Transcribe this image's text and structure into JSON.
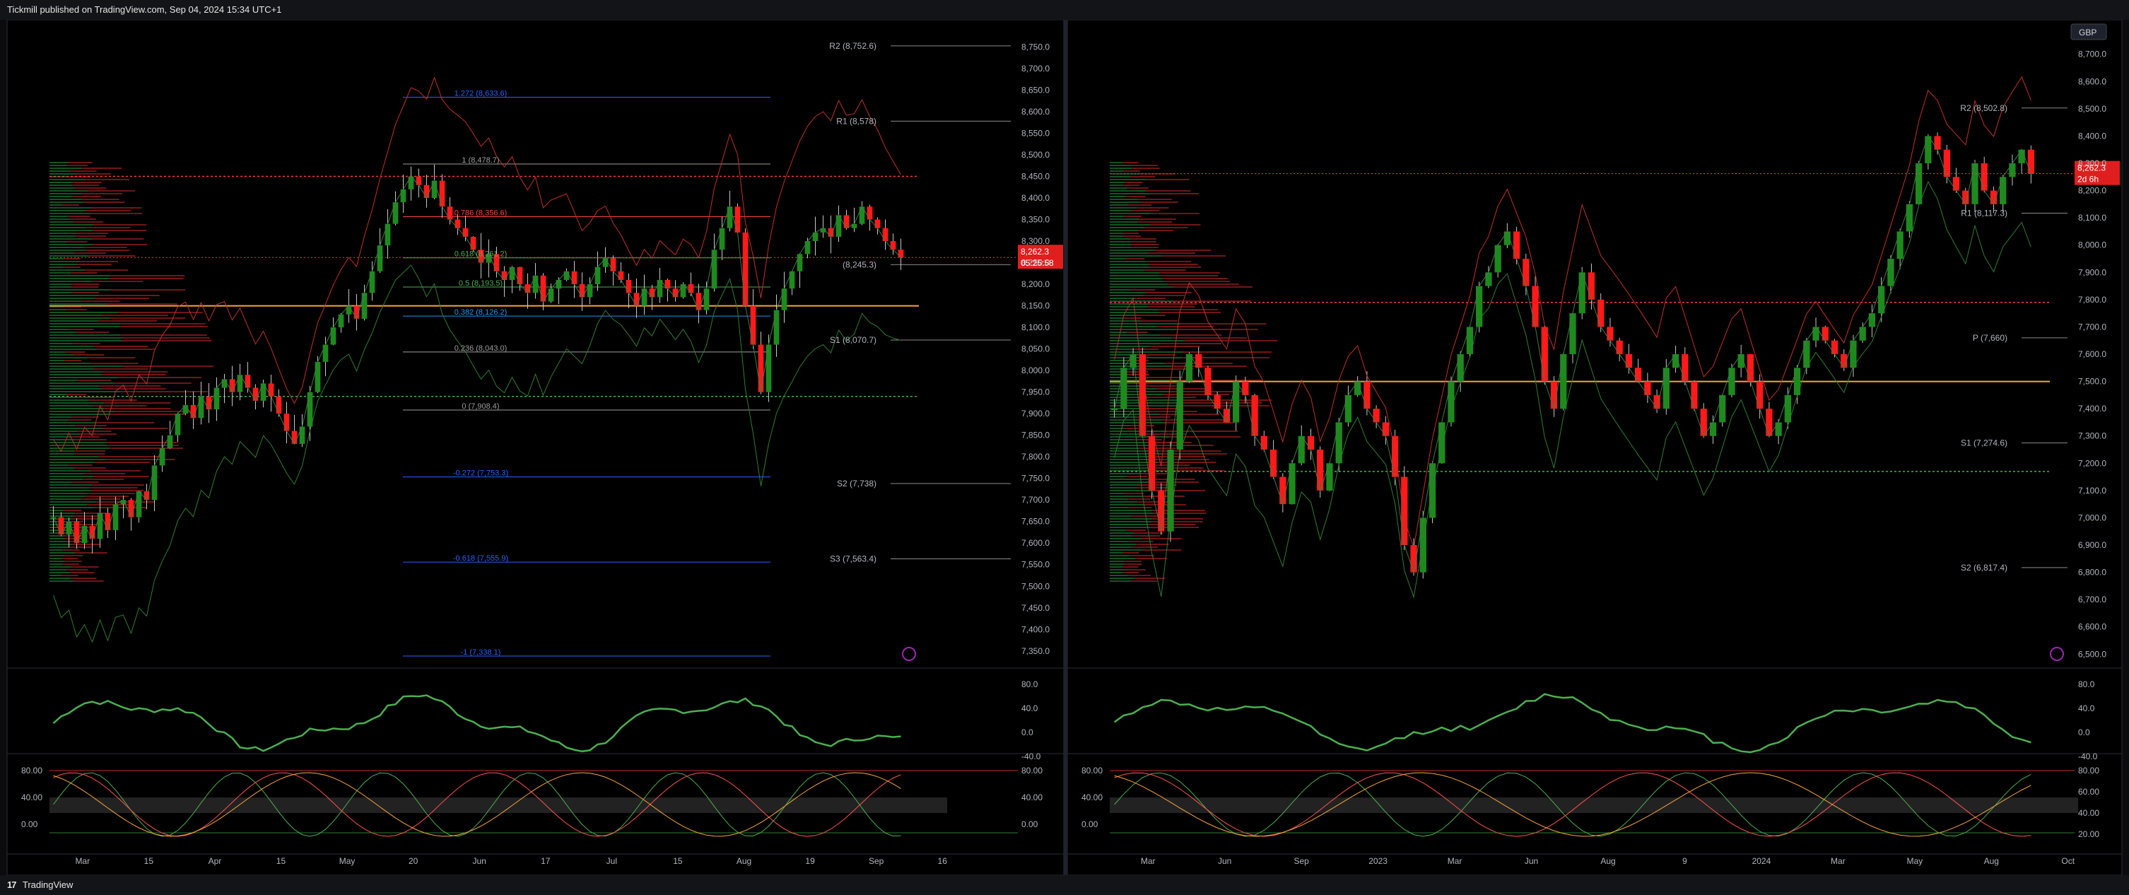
{
  "header": {
    "publish_text": "Tickmill published on TradingView.com, Sep 04, 2024 15:34 UTC+1"
  },
  "footer": {
    "brand": "TradingView",
    "logo_glyph": "17"
  },
  "colors": {
    "bg": "#000000",
    "panel_border": "#2a2e39",
    "up": "#1e8a1e",
    "down": "#ff1a1a",
    "grid_text": "#b2b5be",
    "orange": "#f7a53a",
    "blue_fib": "#2962ff",
    "bb": "#c0302a",
    "bb_green": "#2e7d32"
  },
  "chart_data": [
    {
      "type": "candlestick",
      "panel": "left",
      "timeframe_labels": [
        "Mar",
        "15",
        "Apr",
        "15",
        "May",
        "20",
        "Jun",
        "17",
        "Jul",
        "15",
        "Aug",
        "19",
        "Sep",
        "16"
      ],
      "ylim": [
        7330,
        8790
      ],
      "y_ticks": [
        "8,750.0",
        "8,700.0",
        "8,650.0",
        "8,600.0",
        "8,550.0",
        "8,500.0",
        "8,450.0",
        "8,400.0",
        "8,350.0",
        "8,300.0",
        "8,250.0",
        "8,200.0",
        "8,150.0",
        "8,100.0",
        "8,050.0",
        "8,000.0",
        "7,950.0",
        "7,900.0",
        "7,850.0",
        "7,800.0",
        "7,750.0",
        "7,700.0",
        "7,650.0",
        "7,600.0",
        "7,550.0",
        "7,500.0",
        "7,450.0",
        "7,400.0",
        "7,350.0"
      ],
      "last_price": "8,262.3",
      "countdown": "05:25:58",
      "pivot_levels": [
        {
          "label": "R2 (8,752.6)",
          "value": 8752.6
        },
        {
          "label": "R1 (8,578)",
          "value": 8578
        },
        {
          "label": "(8,245.3)",
          "value": 8245.3
        },
        {
          "label": "S1 (8,070.7)",
          "value": 8070.7
        },
        {
          "label": "S2 (7,738)",
          "value": 7738
        },
        {
          "label": "S3 (7,563.4)",
          "value": 7563.4
        }
      ],
      "fib_levels": [
        {
          "label": "1.272 (8,633.6)",
          "value": 8633.6,
          "color": "#2962ff"
        },
        {
          "label": "1 (8,478.7)",
          "value": 8478.7,
          "color": "#9e9e9e"
        },
        {
          "label": "0.786 (8,356.6)",
          "value": 8356.6,
          "color": "#ff4444"
        },
        {
          "label": "0.618 (8,261.2)",
          "value": 8261.2,
          "color": "#4caf50"
        },
        {
          "label": "0.5 (8,193.5)",
          "value": 8193.5,
          "color": "#4caf50"
        },
        {
          "label": "0.382 (8,126.2)",
          "value": 8126.2,
          "color": "#2196f3"
        },
        {
          "label": "0.236 (8,043.0)",
          "value": 8043.0,
          "color": "#9e9e9e"
        },
        {
          "label": "0 (7,908.4)",
          "value": 7908.4,
          "color": "#9e9e9e"
        },
        {
          "label": "-0.272 (7,753.3)",
          "value": 7753.3,
          "color": "#2962ff"
        },
        {
          "label": "-0.618 (7,555.9)",
          "value": 7555.9,
          "color": "#2962ff"
        },
        {
          "label": "-1 (7,338.1)",
          "value": 7338.1,
          "color": "#2962ff"
        }
      ],
      "horizontal_lines": [
        {
          "value": 8150,
          "color": "#f7a53a",
          "style": "solid"
        },
        {
          "value": 8450,
          "color": "#ff3b3b",
          "style": "dotted"
        },
        {
          "value": 7940,
          "color": "#4caf50",
          "style": "dotted"
        }
      ],
      "candles": [
        7660,
        7620,
        7650,
        7600,
        7640,
        7610,
        7670,
        7630,
        7690,
        7700,
        7660,
        7720,
        7700,
        7780,
        7820,
        7850,
        7900,
        7920,
        7890,
        7940,
        7910,
        7960,
        7980,
        7950,
        7990,
        7960,
        7930,
        7970,
        7940,
        7900,
        7860,
        7830,
        7870,
        7950,
        8020,
        8060,
        8100,
        8130,
        8150,
        8120,
        8180,
        8230,
        8290,
        8340,
        8390,
        8420,
        8450,
        8430,
        8400,
        8440,
        8380,
        8350,
        8330,
        8310,
        8280,
        8250,
        8270,
        8230,
        8210,
        8240,
        8200,
        8180,
        8220,
        8160,
        8190,
        8210,
        8230,
        8200,
        8170,
        8200,
        8240,
        8260,
        8230,
        8210,
        8180,
        8150,
        8190,
        8170,
        8210,
        8190,
        8170,
        8200,
        8180,
        8140,
        8190,
        8280,
        8330,
        8380,
        8320,
        8150,
        8060,
        7950,
        8060,
        8140,
        8190,
        8230,
        8270,
        8300,
        8320,
        8330,
        8310,
        8360,
        8330,
        8340,
        8380,
        8350,
        8330,
        8300,
        8280,
        8262
      ],
      "momentum": {
        "y_ticks": [
          "80.0",
          "40.0",
          "0.0",
          "-40.0"
        ]
      },
      "stoch": {
        "y_ticks": [
          "80.00",
          "40.00",
          "0.00"
        ]
      }
    },
    {
      "type": "candlestick",
      "panel": "right",
      "timeframe_labels": [
        "Mar",
        "Jun",
        "Sep",
        "2023",
        "Mar",
        "Jun",
        "Aug",
        "9",
        "2024",
        "Mar",
        "May",
        "Aug",
        "Oct"
      ],
      "ylim": [
        6480,
        8790
      ],
      "y_ticks": [
        "8,700.0",
        "8,600.0",
        "8,500.0",
        "8,400.0",
        "8,300.0",
        "8,200.0",
        "8,100.0",
        "8,000.0",
        "7,900.0",
        "7,800.0",
        "7,700.0",
        "7,600.0",
        "7,500.0",
        "7,400.0",
        "7,300.0",
        "7,200.0",
        "7,100.0",
        "7,000.0",
        "6,900.0",
        "6,800.0",
        "6,700.0",
        "6,600.0",
        "6,500.0"
      ],
      "currency": "GBP",
      "last_price": "8,262.3",
      "countdown": "2d 6h",
      "pivot_levels": [
        {
          "label": "R2 (8,502.8)",
          "value": 8502.8
        },
        {
          "label": "R1 (8,117.3)",
          "value": 8117.3
        },
        {
          "label": "P (7,660)",
          "value": 7660
        },
        {
          "label": "S1 (7,274.6)",
          "value": 7274.6
        },
        {
          "label": "S2 (6,817.4)",
          "value": 6817.4
        }
      ],
      "horizontal_lines": [
        {
          "value": 7500,
          "color": "#f7a53a",
          "style": "solid"
        },
        {
          "value": 7790,
          "color": "#ff3b3b",
          "style": "dotted"
        },
        {
          "value": 7170,
          "color": "#4caf50",
          "style": "dotted"
        }
      ],
      "candles": [
        7400,
        7550,
        7600,
        7300,
        7100,
        6950,
        7250,
        7500,
        7600,
        7550,
        7450,
        7400,
        7350,
        7500,
        7450,
        7300,
        7250,
        7150,
        7050,
        7200,
        7300,
        7250,
        7100,
        7200,
        7350,
        7450,
        7500,
        7400,
        7350,
        7300,
        7150,
        6900,
        6800,
        7000,
        7200,
        7350,
        7500,
        7600,
        7700,
        7850,
        7900,
        8000,
        8050,
        7950,
        7850,
        7700,
        7500,
        7400,
        7600,
        7750,
        7900,
        7800,
        7700,
        7650,
        7600,
        7550,
        7500,
        7450,
        7400,
        7550,
        7600,
        7500,
        7400,
        7300,
        7350,
        7450,
        7550,
        7600,
        7500,
        7400,
        7300,
        7350,
        7450,
        7550,
        7650,
        7700,
        7650,
        7600,
        7550,
        7650,
        7700,
        7750,
        7850,
        7950,
        8050,
        8150,
        8300,
        8400,
        8350,
        8250,
        8200,
        8150,
        8300,
        8200,
        8150,
        8250,
        8300,
        8350,
        8262
      ],
      "momentum": {
        "y_ticks": [
          "80.0",
          "40.0",
          "0.0",
          "-40.0"
        ]
      },
      "stoch": {
        "y_ticks": [
          "80.00",
          "60.00",
          "40.00",
          "20.00"
        ],
        "left_ticks": [
          "80.00",
          "40.00",
          "0.00"
        ]
      }
    }
  ]
}
